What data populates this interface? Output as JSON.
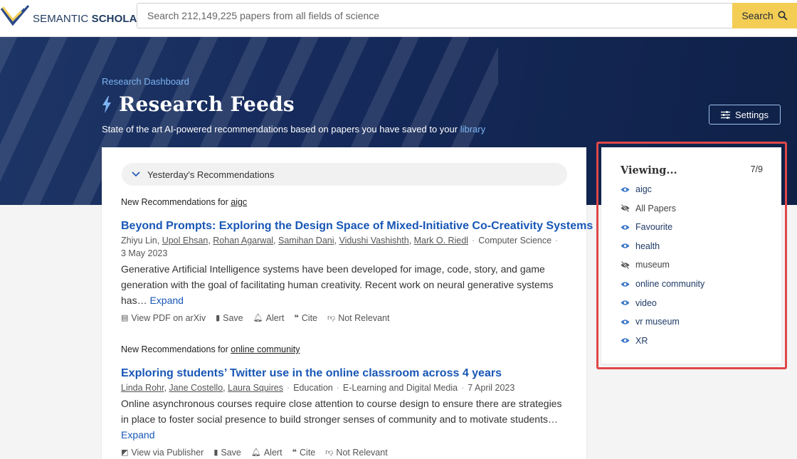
{
  "header": {
    "logo_text_1": "SEMANTIC",
    "logo_text_2": "SCHOLAR",
    "search_placeholder": "Search 212,149,225 papers from all fields of science",
    "search_label": "Search"
  },
  "hero": {
    "breadcrumb": "Research Dashboard",
    "title": "Research Feeds",
    "subtitle_prefix": "State of the art AI-powered recommendations based on papers you have saved to your",
    "subtitle_link": "library",
    "settings_label": "Settings"
  },
  "feed": {
    "section_label": "Yesterday's Recommendations",
    "groups": [
      {
        "prefix": "New Recommendations for",
        "topic": "aigc",
        "paper": {
          "title": "Beyond Prompts: Exploring the Design Space of Mixed-Initiative Co-Creativity Systems",
          "first_author": "Zhiyu Lin",
          "authors": [
            "Upol Ehsan",
            "Rohan Agarwal",
            "Samihan Dani",
            "Vidushi Vashishth",
            "Mark O. Riedl"
          ],
          "field": "Computer Science",
          "date": "3 May 2023",
          "abstract": "Generative Artificial Intelligence systems have been developed for image, code, story, and game generation with the goal of facilitating human creativity. Recent work on neural generative systems has…",
          "expand": "Expand",
          "actions": [
            "View PDF on arXiv",
            "Save",
            "Alert",
            "Cite",
            "Not Relevant"
          ]
        }
      },
      {
        "prefix": "New Recommendations for",
        "topic": "online community",
        "paper": {
          "title": "Exploring students’ Twitter use in the online classroom across 4 years",
          "authors": [
            "Linda Rohr",
            "Jane Costello",
            "Laura Squires"
          ],
          "field": "Education",
          "field2": "E-Learning and Digital Media",
          "date": "7 April 2023",
          "abstract": "Online asynchronous courses require close attention to course design to ensure there are strategies in place to foster social presence to build stronger senses of community and to motivate students…",
          "expand": "Expand",
          "actions": [
            "View via Publisher",
            "Save",
            "Alert",
            "Cite",
            "Not Relevant"
          ]
        }
      }
    ]
  },
  "viewing": {
    "title": "Viewing...",
    "count": "7/9",
    "feeds": [
      {
        "label": "aigc",
        "visible": true
      },
      {
        "label": "All Papers",
        "visible": false
      },
      {
        "label": "Favourite",
        "visible": true
      },
      {
        "label": "health",
        "visible": true
      },
      {
        "label": "museum",
        "visible": false
      },
      {
        "label": "online community",
        "visible": true
      },
      {
        "label": "video",
        "visible": true
      },
      {
        "label": "vr museum",
        "visible": true
      },
      {
        "label": "XR",
        "visible": true
      }
    ]
  },
  "colors": {
    "accent_link": "#1857b6",
    "search_button": "#f4cd54",
    "hero_bg": "#15295a",
    "highlight_box": "#e0474a"
  }
}
